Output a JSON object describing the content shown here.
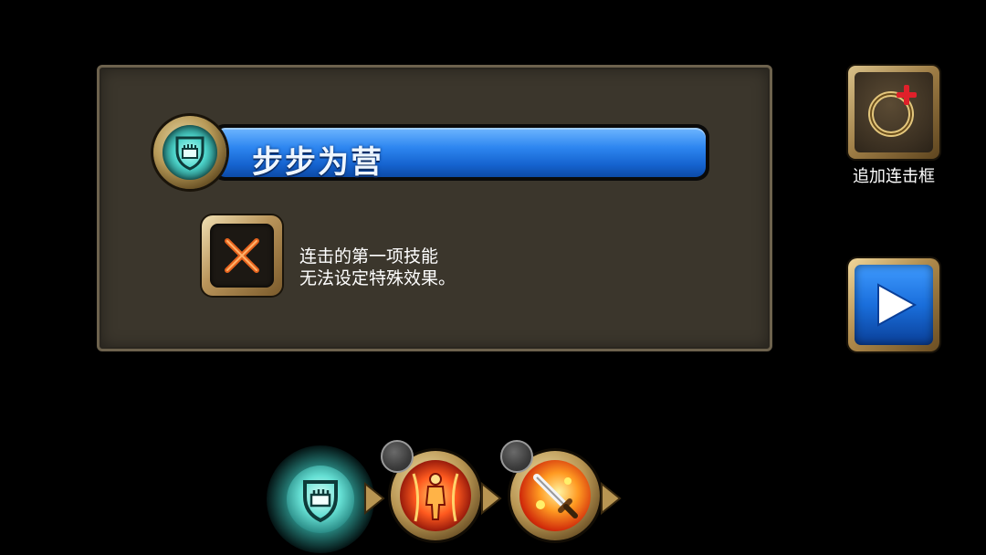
{
  "skill": {
    "name": "步步为营",
    "icon": "shield-fist-icon"
  },
  "effect": {
    "icon": "disabled-x-icon",
    "message_line1": "连击的第一项技能",
    "message_line2": "无法设定特殊效果。"
  },
  "side": {
    "add_combo_label": "追加连击框",
    "add_combo_icon": "ring-plus-icon",
    "next_icon": "play-arrow-icon"
  },
  "combo_chain": [
    {
      "icon": "shield-fist-icon",
      "glow_color": "#5fe0d4"
    },
    {
      "icon": "fire-warrior-icon",
      "color": "#ff5a1f"
    },
    {
      "icon": "flaming-sword-icon",
      "color": "#ff9a22"
    }
  ],
  "colors": {
    "panel_bg": "#3b362c",
    "skill_bar": "#2d86f0",
    "gold_frame": "#b89552",
    "x_mark": "#e8641e"
  }
}
